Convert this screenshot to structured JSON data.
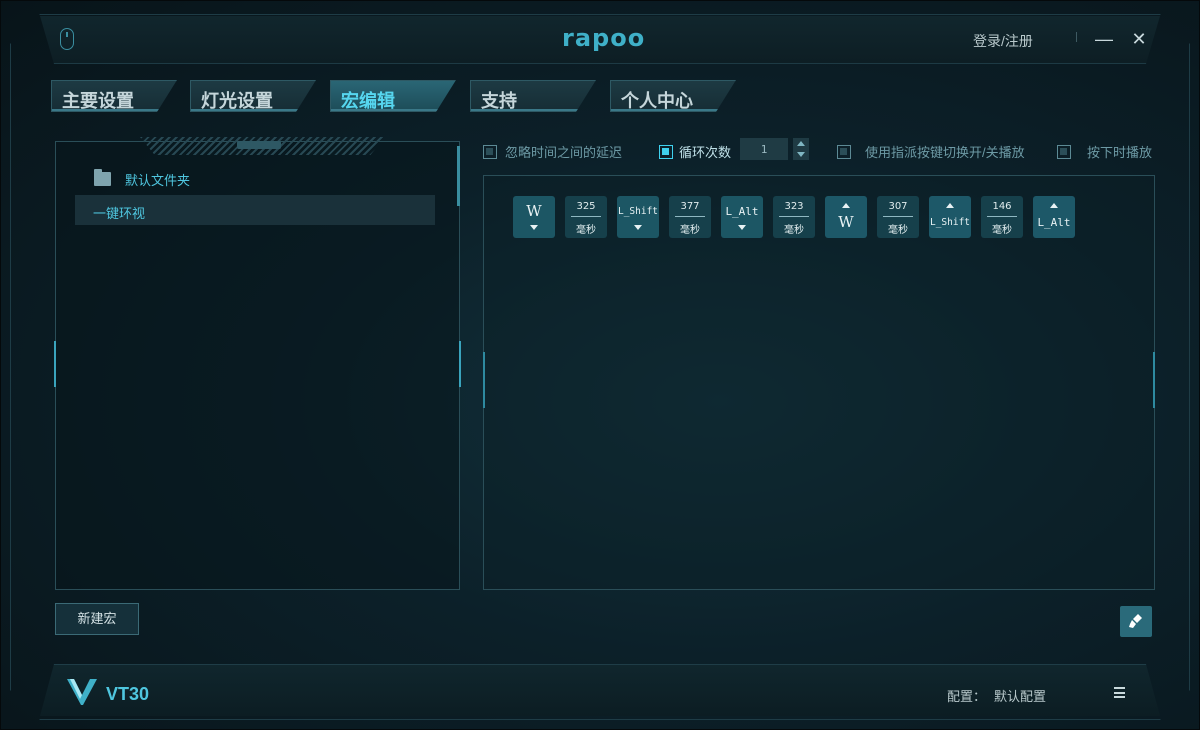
{
  "app": {
    "logo": "rapoo",
    "login_label": "登录/注册",
    "minimize_label": "—",
    "close_label": "✕",
    "accent": "#3fb0c8"
  },
  "tabs": [
    {
      "label": "主要设置",
      "active": false
    },
    {
      "label": "灯光设置",
      "active": false
    },
    {
      "label": "宏编辑",
      "active": true
    },
    {
      "label": "支持",
      "active": false
    },
    {
      "label": "个人中心",
      "active": false
    }
  ],
  "sidebar": {
    "folder_label": "默认文件夹",
    "folder_icon": "folder-icon",
    "macros": [
      "一键环视"
    ],
    "new_macro_label": "新建宏"
  },
  "options": {
    "ignore_delay": {
      "label": "忽略时间之间的延迟",
      "checked": false
    },
    "loop_count": {
      "label": "循环次数",
      "checked": true,
      "value": "1"
    },
    "toggle_key": {
      "label": "使用指派按键切换开/关播放",
      "checked": false
    },
    "hold_play": {
      "label": "按下时播放",
      "checked": false
    }
  },
  "macro_sequence": [
    {
      "type": "down",
      "key": "W"
    },
    {
      "type": "delay",
      "value": "325",
      "unit": "毫秒"
    },
    {
      "type": "down",
      "key": "L_Shift"
    },
    {
      "type": "delay",
      "value": "377",
      "unit": "毫秒"
    },
    {
      "type": "down",
      "key": "L_Alt"
    },
    {
      "type": "delay",
      "value": "323",
      "unit": "毫秒"
    },
    {
      "type": "up",
      "key": "W"
    },
    {
      "type": "delay",
      "value": "307",
      "unit": "毫秒"
    },
    {
      "type": "up",
      "key": "L_Shift"
    },
    {
      "type": "delay",
      "value": "146",
      "unit": "毫秒"
    },
    {
      "type": "up",
      "key": "L_Alt"
    }
  ],
  "footer": {
    "model": "VT30",
    "config_label": "配置：",
    "config_value": "默认配置"
  }
}
